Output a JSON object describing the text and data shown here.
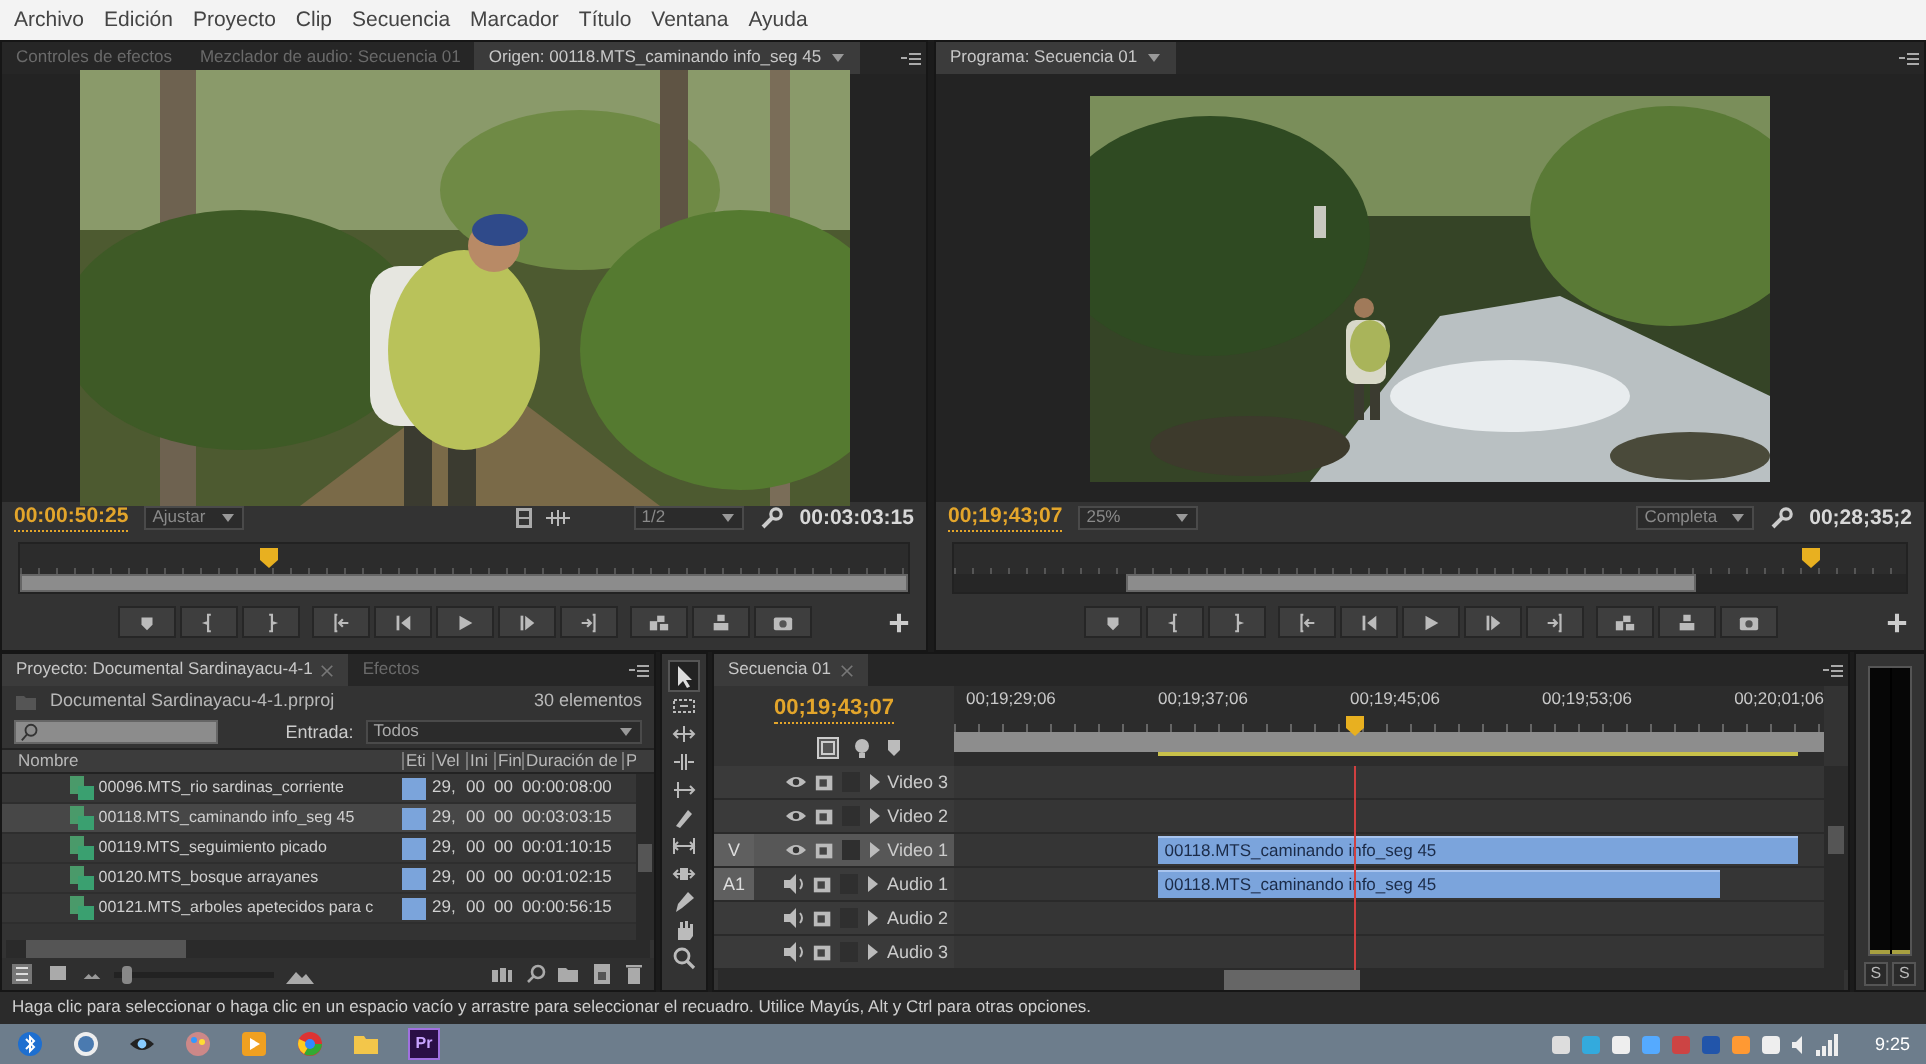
{
  "menu": [
    "Archivo",
    "Edición",
    "Proyecto",
    "Clip",
    "Secuencia",
    "Marcador",
    "Título",
    "Ventana",
    "Ayuda"
  ],
  "source_monitor": {
    "tabs": [
      {
        "label": "Controles de efectos",
        "selected": false
      },
      {
        "label": "Mezclador de audio: Secuencia 01",
        "selected": false
      },
      {
        "label": "Origen: 00118.MTS_caminando info_seg 45",
        "selected": true
      }
    ],
    "current_time": "00:00:50:25",
    "zoom": "Ajustar",
    "resolution": "1/2",
    "duration": "00:03:03:15",
    "playhead": {
      "level": 0.28
    }
  },
  "program_monitor": {
    "tabs": [
      {
        "label": "Programa: Secuencia 01",
        "selected": true
      }
    ],
    "current_time": "00;19;43;07",
    "zoom": "25%",
    "resolution": "Completa",
    "duration": "00;28;35;2",
    "playhead": {
      "level": 0.9
    }
  },
  "project": {
    "tabs": [
      {
        "label": "Proyecto: Documental Sardinayacu-4-1",
        "selected": true
      },
      {
        "label": "Efectos",
        "selected": false
      }
    ],
    "file": "Documental Sardinayacu-4-1.prproj",
    "item_count": "30 elementos",
    "filter_label": "Entrada:",
    "filter_value": "Todos",
    "columns": [
      "Nombre",
      "Eti",
      "Vel",
      "Ini",
      "Fin",
      "Duración de",
      "P"
    ],
    "rows": [
      {
        "name": "00096.MTS_rio sardinas_corriente",
        "color": "#7ba4db",
        "rate": "29,",
        "in": "00",
        "out": "00",
        "duration": "00:00:08:00",
        "selected": false
      },
      {
        "name": "00118.MTS_caminando info_seg 45",
        "color": "#7ba4db",
        "rate": "29,",
        "in": "00",
        "out": "00",
        "duration": "00:03:03:15",
        "selected": true
      },
      {
        "name": "00119.MTS_seguimiento picado",
        "color": "#7ba4db",
        "rate": "29,",
        "in": "00",
        "out": "00",
        "duration": "00:01:10:15",
        "selected": false
      },
      {
        "name": "00120.MTS_bosque arrayanes",
        "color": "#7ba4db",
        "rate": "29,",
        "in": "00",
        "out": "00",
        "duration": "00:01:02:15",
        "selected": false
      },
      {
        "name": "00121.MTS_arboles apetecidos para c",
        "color": "#7ba4db",
        "rate": "29,",
        "in": "00",
        "out": "00",
        "duration": "00:00:56:15",
        "selected": false
      }
    ],
    "zoom_slider": {
      "level": 0.05
    }
  },
  "timeline": {
    "tabs": [
      {
        "label": "Secuencia 01",
        "selected": true
      }
    ],
    "current_time": "00;19;43;07",
    "ruler": [
      "00;19;29;06",
      "00;19;37;06",
      "00;19;45;06",
      "00;19;53;06",
      "00;20;01;06"
    ],
    "playhead": {
      "level": 0.46
    },
    "tracks": [
      {
        "kind": "video",
        "label": "Video 3",
        "selected": false
      },
      {
        "kind": "video",
        "label": "Video 2",
        "selected": false
      },
      {
        "kind": "video",
        "label": "Video 1",
        "target": "V",
        "selected": true,
        "clip": "00118.MTS_caminando info_seg 45"
      },
      {
        "kind": "audio",
        "label": "Audio 1",
        "target": "A1",
        "selected": false,
        "clip": "00118.MTS_caminando info_seg 45"
      },
      {
        "kind": "audio",
        "label": "Audio 2",
        "selected": false
      },
      {
        "kind": "audio",
        "label": "Audio 3",
        "selected": false
      }
    ]
  },
  "audio_meter": {
    "solo_buttons": [
      "S",
      "S"
    ]
  },
  "status_bar": "Haga clic para seleccionar o haga clic en un espacio vacío y arrastre para seleccionar el recuadro. Utilice Mayús, Alt y Ctrl para otras opciones.",
  "taskbar": {
    "app_label": "Pr",
    "clock": "9:25"
  }
}
